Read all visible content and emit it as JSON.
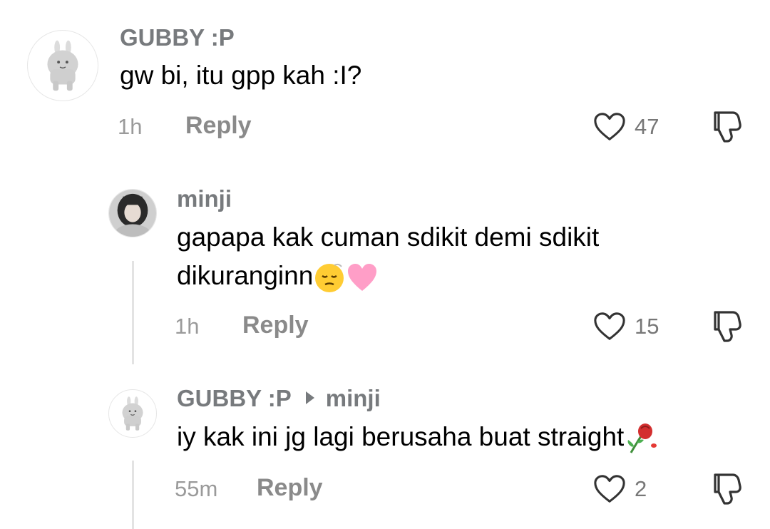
{
  "comments": [
    {
      "username": "GUBBY :P",
      "text": "gw bi, itu gpp kah :I?",
      "time": "1h",
      "reply_label": "Reply",
      "likes": "47"
    },
    {
      "username": "minji",
      "text_line1": "gapapa kak cuman sdikit demi sdikit",
      "text_line2": "dikuranginn",
      "time": "1h",
      "reply_label": "Reply",
      "likes": "15"
    },
    {
      "username": "GUBBY :P",
      "reply_to": "minji",
      "text": "iy kak ini jg lagi berusaha buat straight",
      "time": "55m",
      "reply_label": "Reply",
      "likes": "2"
    }
  ],
  "icons": {
    "like": "heart-outline-icon",
    "dislike": "thumbs-down-outline-icon",
    "reply_arrow": "triangle-right-icon"
  },
  "colors": {
    "username": "#777a7d",
    "muted": "#9a9a9a",
    "icon_stroke": "#333333"
  }
}
